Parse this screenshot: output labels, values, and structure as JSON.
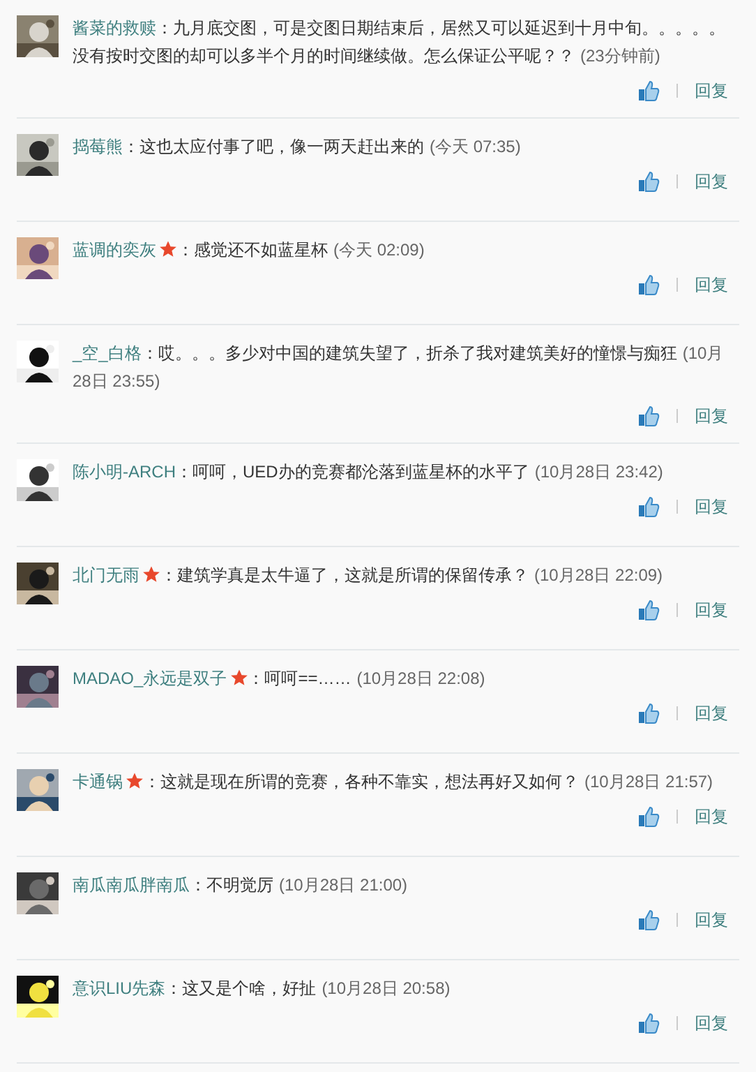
{
  "comments": [
    {
      "user": "酱菜的救赎",
      "badge": false,
      "colon": "：",
      "text": "九月底交图，可是交图日期结束后，居然又可以延迟到十月中旬。。。。。没有按时交图的却可以多半个月的时间继续做。怎么保证公平呢？？",
      "time": "(23分钟前)",
      "reply": "回复"
    },
    {
      "user": "捣莓熊",
      "badge": false,
      "colon": "：",
      "text": "这也太应付事了吧，像一两天赶出来的",
      "time": "(今天  07:35)",
      "reply": "回复"
    },
    {
      "user": "蓝调的奕灰",
      "badge": true,
      "colon": "：",
      "text": "感觉还不如蓝星杯",
      "time": "(今天  02:09)",
      "reply": "回复"
    },
    {
      "user": "_空_白格",
      "badge": false,
      "colon": "：",
      "text": "哎。。。多少对中国的建筑失望了，折杀了我对建筑美好的憧憬与痴狂",
      "time": "(10月28日  23:55)",
      "reply": "回复"
    },
    {
      "user": "陈小明-ARCH",
      "badge": false,
      "colon": "：",
      "text": "呵呵，UED办的竞赛都沦落到蓝星杯的水平了",
      "time": "(10月28日  23:42)",
      "reply": "回复"
    },
    {
      "user": "北门无雨",
      "badge": true,
      "colon": "：",
      "text": "建筑学真是太牛逼了，这就是所谓的保留传承？",
      "time": "(10月28日  22:09)",
      "reply": "回复"
    },
    {
      "user": "MADAO_永远是双子",
      "badge": true,
      "colon": "：",
      "text": "呵呵==……",
      "time": "(10月28日  22:08)",
      "reply": "回复"
    },
    {
      "user": "卡通锅",
      "badge": true,
      "colon": "：",
      "text": "这就是现在所谓的竞赛，各种不靠实，想法再好又如何？",
      "time": "(10月28日  21:57)",
      "reply": "回复"
    },
    {
      "user": "南瓜南瓜胖南瓜",
      "badge": false,
      "colon": "：",
      "text": "不明觉厉",
      "time": "(10月28日  21:00)",
      "reply": "回复"
    },
    {
      "user": "意识LIU先森",
      "badge": false,
      "colon": "：",
      "text": "这又是个啥，好扯",
      "time": "(10月28日  20:58)",
      "reply": "回复"
    }
  ]
}
